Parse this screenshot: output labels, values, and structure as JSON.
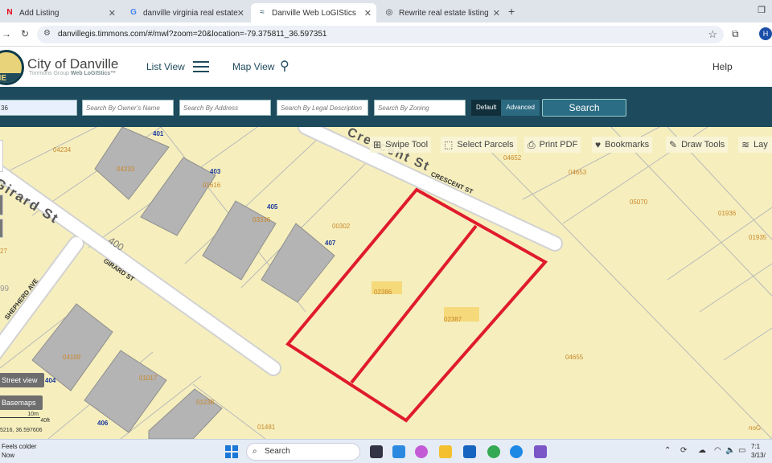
{
  "browser": {
    "tabs": [
      {
        "label": "Add Listing",
        "icon": "N"
      },
      {
        "label": "danville virginia real estate tax",
        "icon": "G"
      },
      {
        "label": "Danville Web LoGIStics",
        "icon": "≈"
      },
      {
        "label": "Rewrite real estate listing",
        "icon": "◎"
      }
    ],
    "url": "danvillegis.timmons.com/#/mwl?zoom=20&location=-79.375811_36.597351",
    "profile_initial": "H"
  },
  "header": {
    "logo_text": "ME",
    "brand": "City of Danville",
    "sub_prefix": "Timmons Group ",
    "sub_bold": "Web LoGIStics™",
    "list_view": "List View",
    "map_view": "Map View",
    "help": "Help"
  },
  "search": {
    "first_value": "36",
    "owner_placeholder": "Search By Owner's Name",
    "address_placeholder": "Search By Address",
    "legal_placeholder": "Search By Legal Description",
    "zoning_placeholder": "Search By Zoning",
    "default_label": "Default",
    "advanced_label": "Advanced",
    "button": "Search"
  },
  "tools": {
    "swipe": "Swipe Tool",
    "select": "Select Parcels",
    "print": "Print PDF",
    "bookmarks": "Bookmarks",
    "draw": "Draw Tools",
    "layers": "Lay"
  },
  "map": {
    "streets": {
      "girard_big": "Girard St",
      "crescent_big": "Crescent St",
      "crescent_small": "CRESCENT ST",
      "girard_small": "GIRARD ST",
      "shepherd": "SHEPHERD AVE",
      "block_400": "400"
    },
    "addresses": [
      "401",
      "403",
      "405",
      "407",
      "404",
      "406"
    ],
    "parcels": [
      "04234",
      "04233",
      "01616",
      "03336",
      "00302",
      "04652",
      "04653",
      "05070",
      "01936",
      "01935",
      "02386",
      "02387",
      "04655",
      "04109",
      "01017",
      "01238",
      "01481",
      "27",
      "99",
      "noG"
    ],
    "street_view": "Street view",
    "basemaps": "Basemaps",
    "scale_m": "10m",
    "scale_ft": "40ft",
    "coords": "5216, 36.597606"
  },
  "taskbar": {
    "weather_line1": "Feels colder",
    "weather_line2": "Now",
    "search": "Search",
    "time": "7:1",
    "date": "3/13/"
  }
}
